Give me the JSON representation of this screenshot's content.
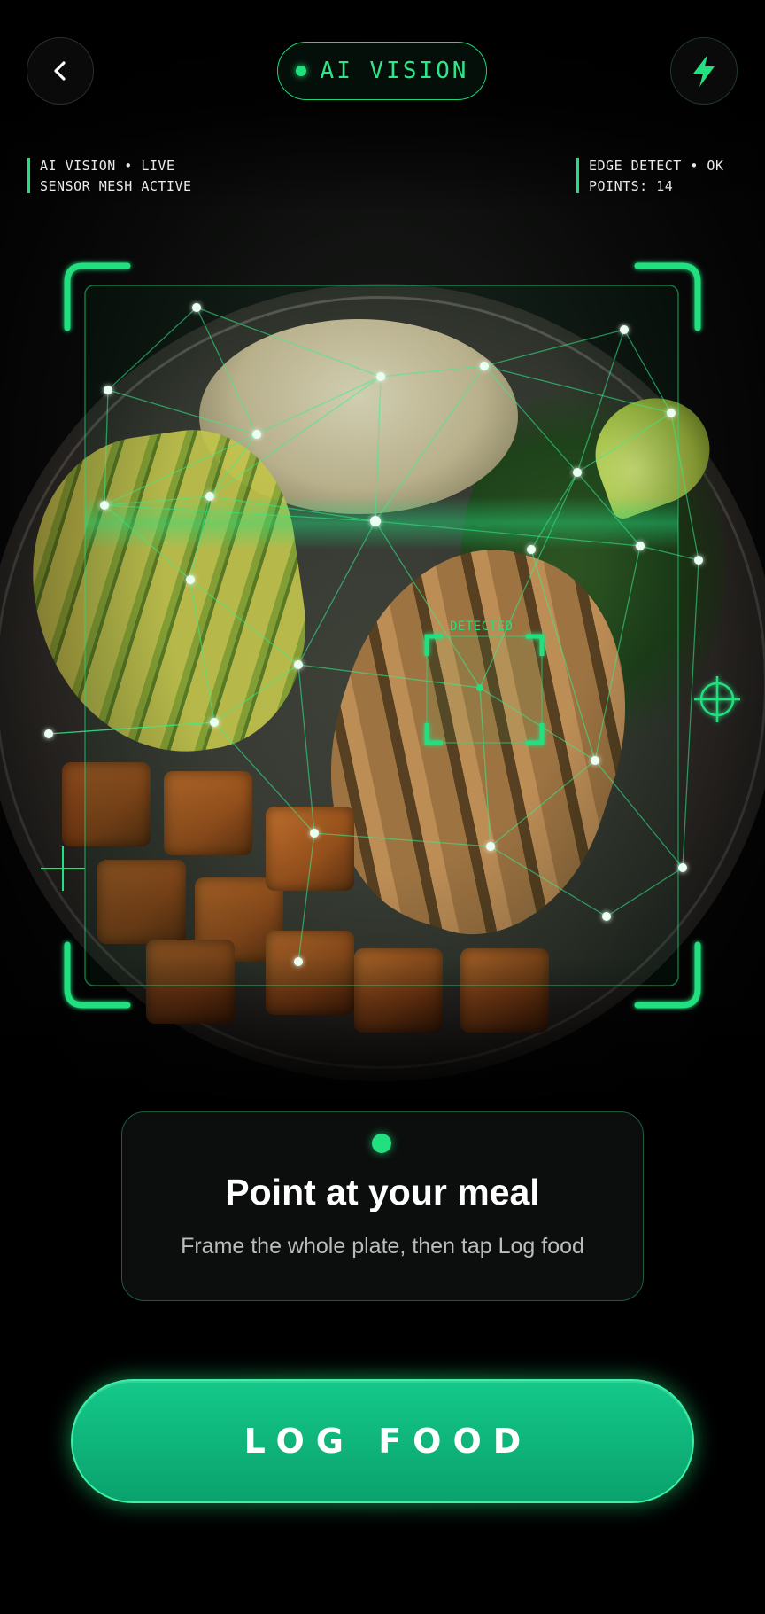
{
  "header": {
    "back_icon": "chevron-left-icon",
    "mode_label": "AI VISION",
    "flash_icon": "lightning-bolt-icon"
  },
  "hud": {
    "left_line1": "AI VISION • LIVE",
    "left_line2": "SENSOR MESH ACTIVE",
    "right_line1": "EDGE DETECT • OK",
    "right_line2": "POINTS: 14"
  },
  "detection": {
    "label": "DETECTED"
  },
  "instruction": {
    "title": "Point at your meal",
    "subtitle": "Frame the whole plate, then tap Log food"
  },
  "action": {
    "log_label": "LOG FOOD"
  },
  "colors": {
    "accent": "#22e07f",
    "button": "#0fb67b",
    "background": "#000000"
  }
}
